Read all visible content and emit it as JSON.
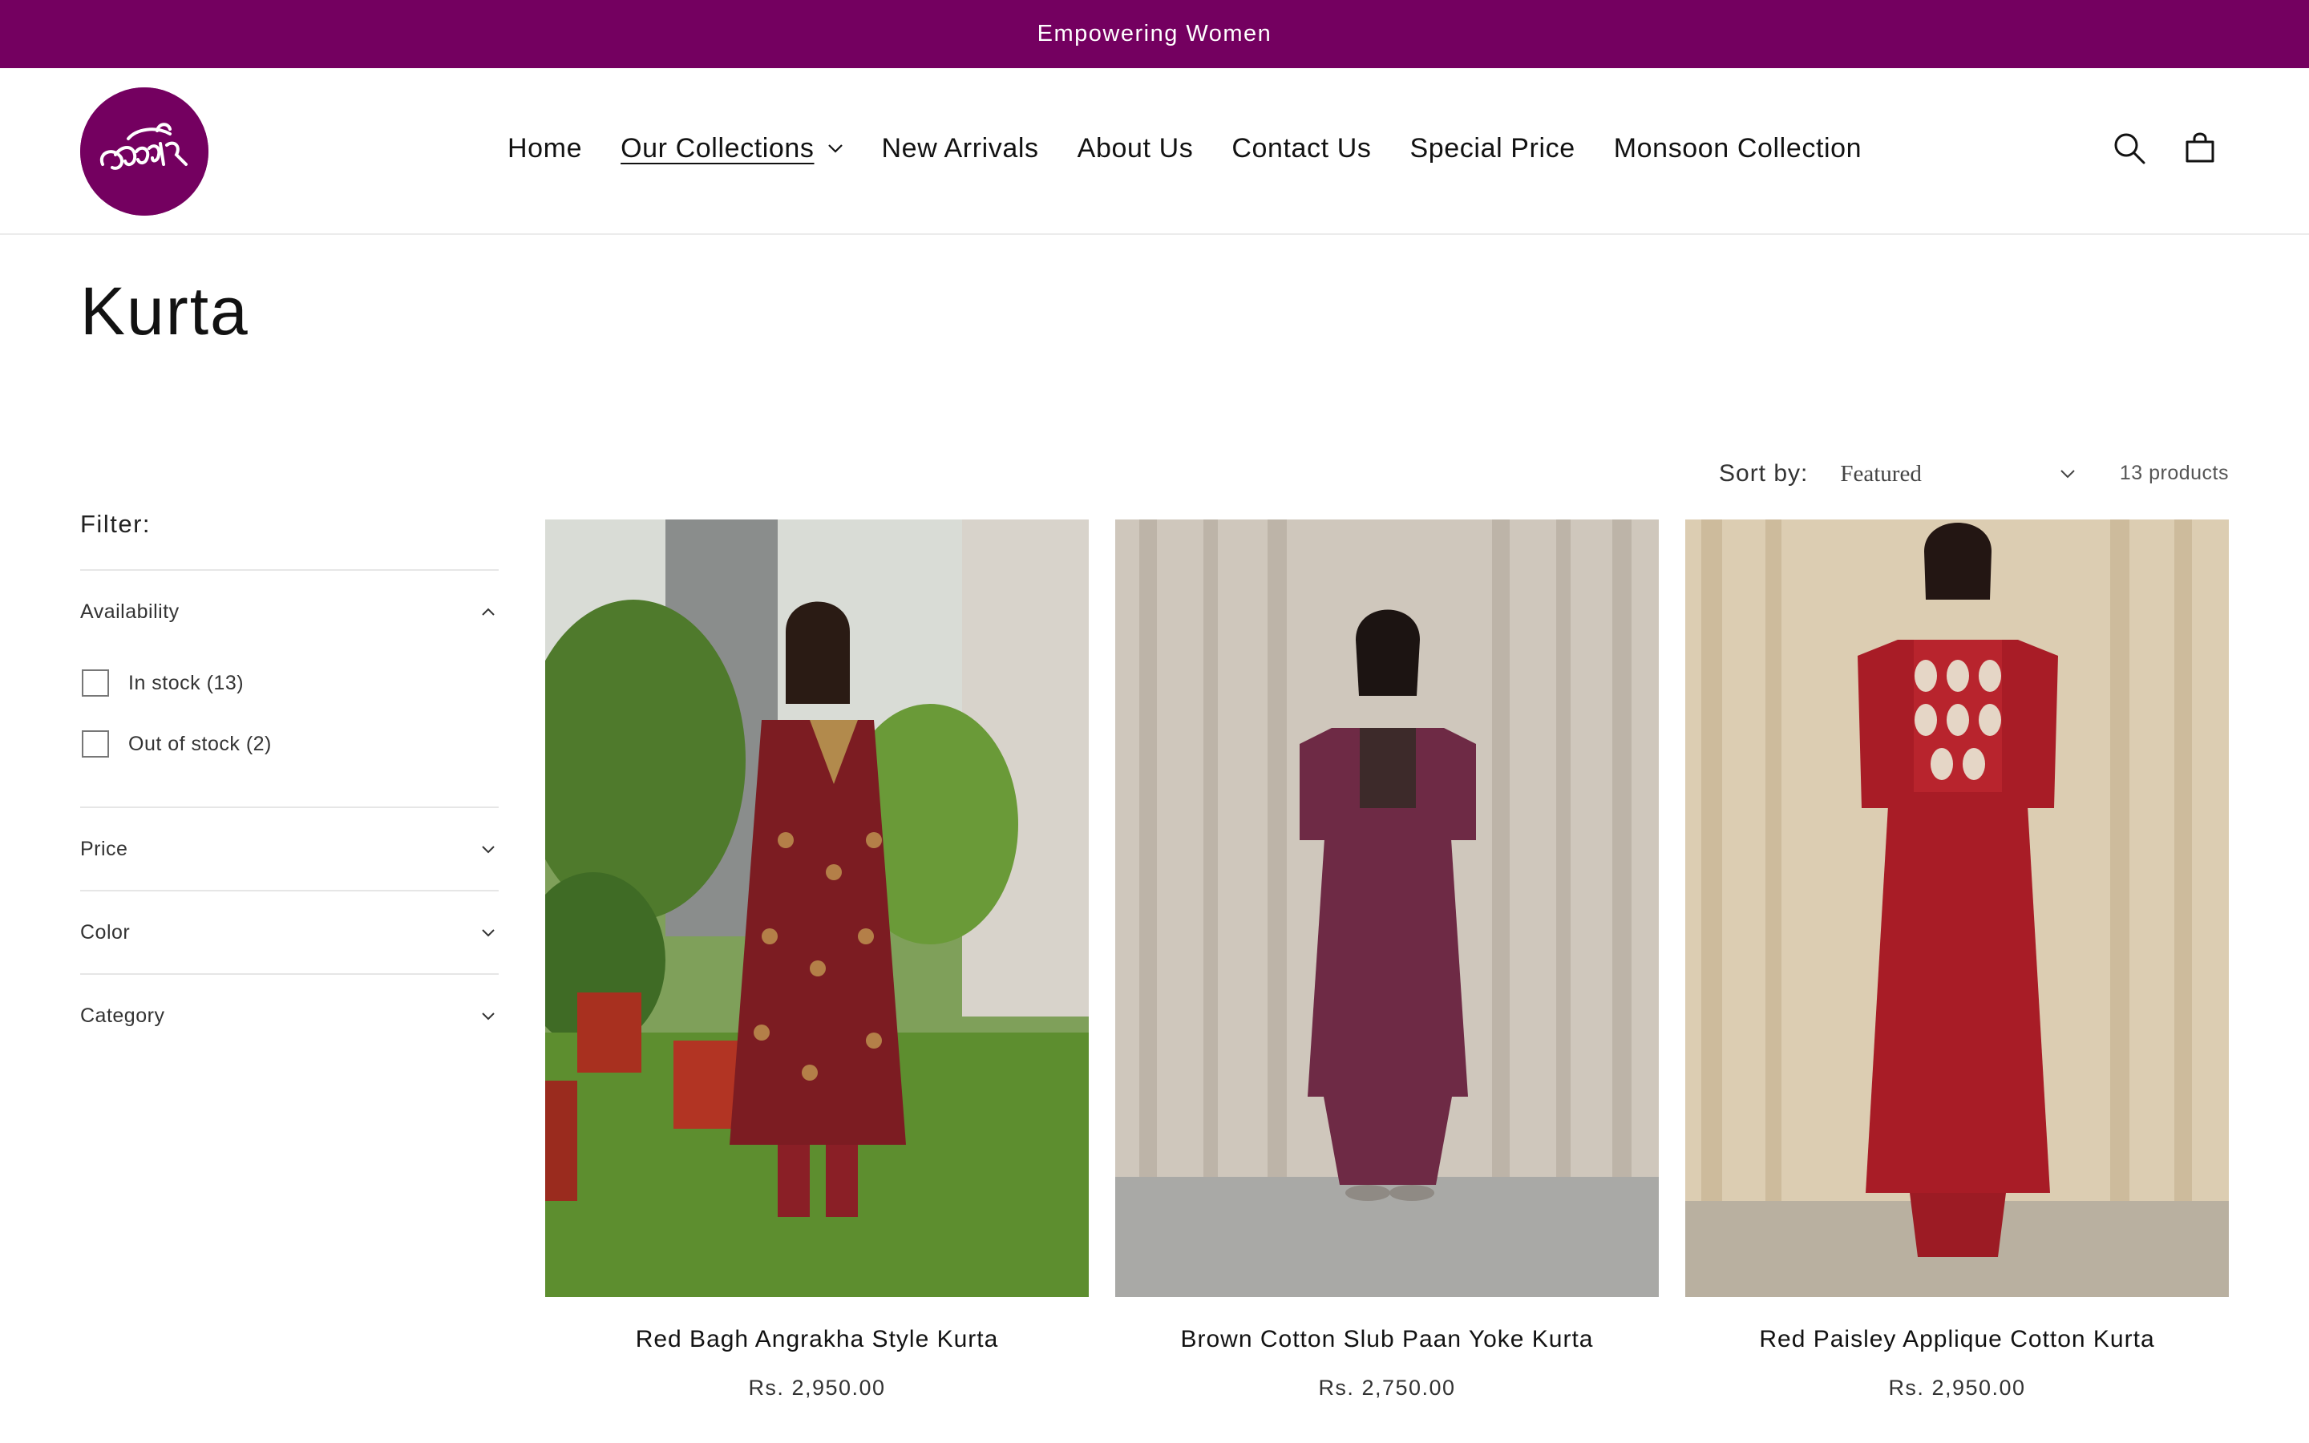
{
  "announcement": "Empowering Women",
  "header": {
    "logo_text": "Jasdīr",
    "nav": [
      {
        "label": "Home"
      },
      {
        "label": "Our Collections"
      },
      {
        "label": "New Arrivals"
      },
      {
        "label": "About Us"
      },
      {
        "label": "Contact Us"
      },
      {
        "label": "Special Price"
      },
      {
        "label": "Monsoon Collection"
      }
    ],
    "active_nav": "Our Collections",
    "icons": [
      "search-icon",
      "cart-icon"
    ]
  },
  "page": {
    "title": "Kurta"
  },
  "sort": {
    "label": "Sort by:",
    "selected": "Featured",
    "count": "13 products"
  },
  "filter": {
    "heading": "Filter:",
    "availability": {
      "label": "Availability",
      "options": [
        {
          "label": "In stock (13)",
          "checked": false
        },
        {
          "label": "Out of stock (2)",
          "checked": false
        }
      ]
    },
    "price": {
      "label": "Price"
    },
    "color": {
      "label": "Color"
    },
    "category": {
      "label": "Category"
    }
  },
  "products": [
    {
      "name": "Red Bagh Angrakha Style Kurta",
      "price": "Rs. 2,950.00"
    },
    {
      "name": "Brown Cotton Slub Paan Yoke Kurta",
      "price": "Rs. 2,750.00"
    },
    {
      "name": "Red Paisley Applique Cotton Kurta",
      "price": "Rs. 2,950.00"
    }
  ],
  "colors": {
    "brand": "#740060",
    "text": "#121212"
  }
}
